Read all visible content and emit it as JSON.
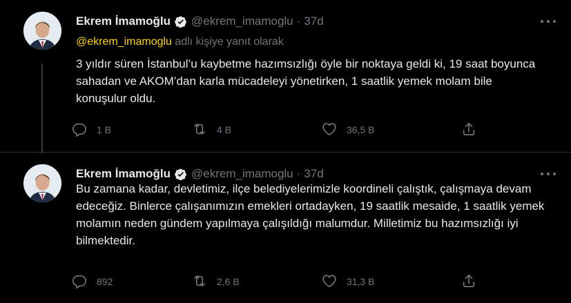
{
  "tweets": [
    {
      "author_name": "Ekrem İmamoğlu",
      "handle": "@ekrem_imamoglu",
      "separator": "·",
      "time": "37d",
      "reply_mention": "@ekrem_imamoglu",
      "reply_suffix": " adlı kişiye yanıt olarak",
      "text": "3 yıldır süren İstanbul’u kaybetme hazımsızlığı öyle bir noktaya geldi ki, 19 saat boyunca sahadan ve AKOM’dan karla mücadeleyi yönetirken, 1 saatlik yemek molam bile konuşulur oldu.",
      "replies": "1 B",
      "retweets": "4 B",
      "likes": "36,5 B"
    },
    {
      "author_name": "Ekrem İmamoğlu",
      "handle": "@ekrem_imamoglu",
      "separator": "·",
      "time": "37d",
      "text": "Bu zamana kadar, devletimiz, ilçe belediyelerimizle koordineli çalıştık, çalışmaya devam edeceğiz. Binlerce çalışanımızın emekleri ortadayken, 19 saatlik mesaide, 1 saatlik yemek molamın neden gündem yapılmaya çalışıldığı malumdur. Milletimiz bu hazımsızlığı iyi bilmektedir.",
      "replies": "892",
      "retweets": "2,6 B",
      "likes": "31,3 B"
    }
  ],
  "icons": {
    "verified": "verified-badge-icon",
    "reply": "reply-icon",
    "retweet": "retweet-icon",
    "like": "heart-icon",
    "share": "share-icon",
    "more": "more-icon"
  },
  "colors": {
    "background": "#000000",
    "text": "#e7e9ea",
    "secondary": "#71767b",
    "mention": "#ffd400",
    "divider": "#2f3336"
  }
}
